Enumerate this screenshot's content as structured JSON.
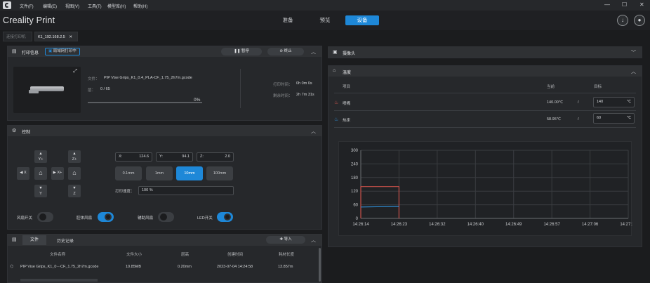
{
  "menubar": {
    "items": [
      "文件(F)",
      "编辑(E)",
      "视图(V)",
      "工具(T)",
      "模型库(H)",
      "帮助(H)"
    ],
    "window_controls": [
      "—",
      "☐",
      "✕"
    ]
  },
  "app": {
    "title": "Creality Print"
  },
  "main_tabs": [
    {
      "label": "准备",
      "active": false
    },
    {
      "label": "预览",
      "active": false
    },
    {
      "label": "设备",
      "active": true
    }
  ],
  "header_buttons": [
    {
      "icon": "download-icon"
    },
    {
      "icon": "user-icon"
    }
  ],
  "device_tabs": [
    {
      "label": "连接打印机",
      "active": false
    },
    {
      "label": "K1_192.168.2.5",
      "active": true,
      "close": "✕"
    }
  ],
  "print_info": {
    "title": "打印信息",
    "mode_badge": "局域网打印中",
    "pause_label": "暂停",
    "stop_label": "终止",
    "file_label": "文件：",
    "file_name": "PIP Vise Grips_K1_0.4_PLA-CF_1.75_2h7m.gcode",
    "layer_label": "层：",
    "layer_value": "0 / 65",
    "progress": "0%",
    "progress_fraction": 0,
    "print_time_label": "打印时间：",
    "print_time": "0h 0m 0s",
    "remaining_label": "剩余时间：",
    "remaining": "2h 7m 31s"
  },
  "control": {
    "title": "控制",
    "jog": {
      "y_plus": "Y+",
      "z_plus": "Z+",
      "x_minus": "X",
      "x_plus": "X+",
      "y_minus": "Y",
      "z_minus": "Z"
    },
    "x_label": "X:",
    "x_value": "124.6",
    "y_label": "Y:",
    "y_value": "94.1",
    "z_label": "Z:",
    "z_value": "2.0",
    "steps": [
      {
        "label": "0.1mm",
        "active": false
      },
      {
        "label": "1mm",
        "active": false
      },
      {
        "label": "10mm",
        "active": true
      },
      {
        "label": "100mm",
        "active": false
      }
    ],
    "speed_label": "打印速度：",
    "speed_value": "100 %",
    "toggles": [
      {
        "label": "风扇开关",
        "on": false
      },
      {
        "label": "腔体风扇",
        "on": true
      },
      {
        "label": "辅助风扇",
        "on": false
      },
      {
        "label": "LED开关",
        "on": true
      }
    ]
  },
  "files": {
    "tabs": [
      "文件",
      "历史记录"
    ],
    "import_label": "导入",
    "columns": [
      "文件名称",
      "文件大小",
      "层高",
      "创建时间",
      "耗材长度"
    ],
    "rows": [
      {
        "name": "PIP Vise Grips_K1_0⋯CF_1.75_2h7m.gcode",
        "size": "10.85MB",
        "layer": "0.20mm",
        "created": "2023-07-04 14:24:58",
        "length": "13.857m"
      }
    ]
  },
  "camera": {
    "title": "摄像头"
  },
  "temperature": {
    "title": "温度",
    "col_item": "项目",
    "col_current": "当前",
    "col_target": "目标",
    "rows": [
      {
        "name": "喷嘴",
        "current": "140.00℃",
        "sep": "/",
        "target": "140",
        "unit": "℃"
      },
      {
        "name": "热床",
        "current": "58.95℃",
        "sep": "/",
        "target": "60",
        "unit": "℃"
      }
    ]
  },
  "chart_data": {
    "type": "line",
    "x": [
      "14:26:14",
      "14:26:23",
      "14:26:32",
      "14:26:40",
      "14:26:49",
      "14:26:57",
      "14:27:06",
      "14:27:14"
    ],
    "yticks": [
      "300",
      "240",
      "180",
      "120",
      "60",
      "0"
    ],
    "ylim": [
      0,
      300
    ],
    "series": [
      {
        "key": "nozzle",
        "color": "#c8504a",
        "points": [
          [
            0,
            0
          ],
          [
            0,
            140
          ],
          [
            1,
            140
          ],
          [
            1,
            0
          ]
        ]
      },
      {
        "key": "bed",
        "color": "#2f8fd8",
        "points": [
          [
            0,
            50
          ],
          [
            1,
            53
          ]
        ]
      }
    ],
    "grid": true
  }
}
